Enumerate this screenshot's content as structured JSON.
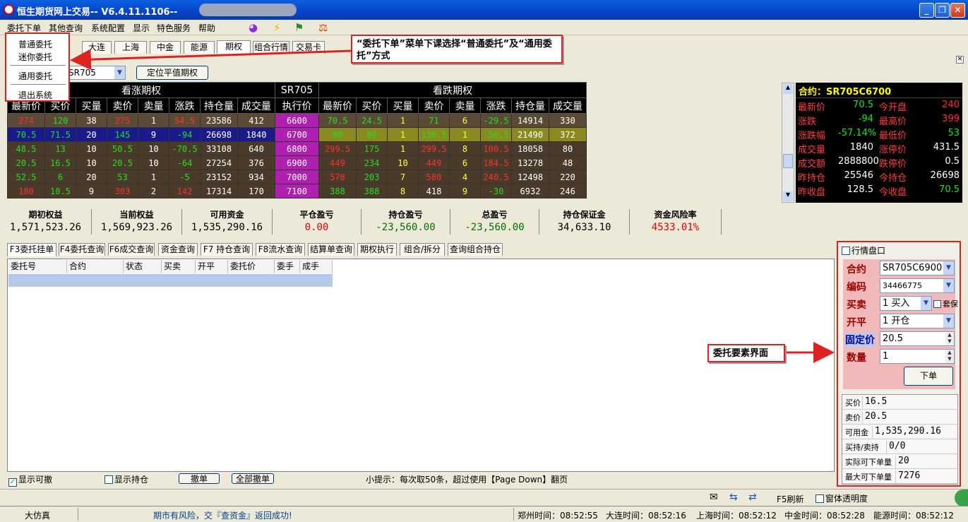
{
  "window": {
    "title": "恒生期货网上交易-- V6.4.11.1106--"
  },
  "menu": {
    "items": [
      "委托下单",
      "其他查询",
      "系统配置",
      "显示",
      "特色服务",
      "帮助"
    ]
  },
  "dropdown": {
    "items": [
      "普通委托",
      "迷你委托",
      "通用委托",
      "退出系统"
    ]
  },
  "callout_menu": "“委托下单”菜单下课选择“普通委托”及“通用委托”方式",
  "callout_panel": "委托要素界面",
  "exch_tabs": [
    "大连",
    "上海",
    "中金",
    "能源",
    "期权",
    "组合行情",
    "交易卡"
  ],
  "contract_select": "SR705",
  "locate_button": "定位平值期权",
  "option": {
    "call_group": "看涨期权",
    "strike_group": "SR705",
    "put_group": "看跌期权",
    "call_headers": [
      "最新价",
      "买价",
      "买量",
      "卖价",
      "卖量",
      "涨跌",
      "持仓量",
      "成交量"
    ],
    "strike_header": "执行价",
    "put_headers": [
      "最新价",
      "买价",
      "买量",
      "卖价",
      "卖量",
      "涨跌",
      "持仓量",
      "成交量"
    ],
    "rows": [
      {
        "c": [
          "274",
          "120",
          "38",
          "275",
          "1",
          "54.5",
          "23586",
          "412"
        ],
        "k": "6600",
        "p": [
          "70.5",
          "24.5",
          "1",
          "71",
          "6",
          "-29.5",
          "14914",
          "330"
        ]
      },
      {
        "c": [
          "70.5",
          "71.5",
          "20",
          "145",
          "9",
          "-94",
          "26698",
          "1840"
        ],
        "k": "6700",
        "p": [
          "88",
          "69",
          "1",
          "136.5",
          "1",
          "-56.5",
          "21490",
          "372"
        ]
      },
      {
        "c": [
          "48.5",
          "13",
          "10",
          "50.5",
          "10",
          "-70.5",
          "33108",
          "640"
        ],
        "k": "6800",
        "p": [
          "299.5",
          "175",
          "1",
          "299.5",
          "8",
          "100.5",
          "18058",
          "80"
        ]
      },
      {
        "c": [
          "20.5",
          "16.5",
          "10",
          "20.5",
          "10",
          "-64",
          "27254",
          "376"
        ],
        "k": "6900",
        "p": [
          "449",
          "234",
          "10",
          "449",
          "6",
          "184.5",
          "13278",
          "48"
        ]
      },
      {
        "c": [
          "52.5",
          "6",
          "20",
          "53",
          "1",
          "-5",
          "23152",
          "934"
        ],
        "k": "7000",
        "p": [
          "578",
          "203",
          "7",
          "580",
          "4",
          "240.5",
          "12498",
          "220"
        ]
      },
      {
        "c": [
          "180",
          "10.5",
          "9",
          "303",
          "2",
          "142",
          "17314",
          "170"
        ],
        "k": "7100",
        "p": [
          "388",
          "388",
          "8",
          "418",
          "9",
          "-30",
          "6932",
          "246"
        ]
      }
    ]
  },
  "quote": {
    "title": "合约：SR705C6700",
    "rows": [
      {
        "l": "最新价",
        "v": "70.5",
        "l2": "今开盘",
        "v2": "240"
      },
      {
        "l": "涨跌",
        "v": "-94",
        "l2": "最高价",
        "v2": "399"
      },
      {
        "l": "涨跌幅",
        "v": "-57.14%",
        "l2": "最低价",
        "v2": "53"
      },
      {
        "l": "成交量",
        "v": "1840",
        "l2": "涨停价",
        "v2": "431.5"
      },
      {
        "l": "成交额",
        "v": "2888800",
        "l2": "跌停价",
        "v2": "0.5"
      },
      {
        "l": "昨持仓",
        "v": "25546",
        "l2": "今持仓",
        "v2": "26698"
      },
      {
        "l": "昨收盘",
        "v": "128.5",
        "l2": "今收盘",
        "v2": "70.5"
      }
    ]
  },
  "account": [
    {
      "h": "期初权益",
      "v": "1,571,523.26",
      "c": "#000"
    },
    {
      "h": "当前权益",
      "v": "1,569,923.26",
      "c": "#000"
    },
    {
      "h": "可用资金",
      "v": "1,535,290.16",
      "c": "#000"
    },
    {
      "h": "平仓盈亏",
      "v": "0.00",
      "c": "#e00000"
    },
    {
      "h": "持仓盈亏",
      "v": "-23,560.00",
      "c": "#007000"
    },
    {
      "h": "总盈亏",
      "v": "-23,560.00",
      "c": "#007000"
    },
    {
      "h": "持仓保证金",
      "v": "34,633.10",
      "c": "#000"
    },
    {
      "h": "资金风险率",
      "v": "4533.01%",
      "c": "#e00000"
    }
  ],
  "lower_tabs": [
    "F3委托挂单",
    "F4委托查询",
    "F6成交查询",
    "资金查询",
    "F7 持仓查询",
    "F8流水查询",
    "结算单查询",
    "期权执行",
    "组合/拆分",
    "查询组合持仓"
  ],
  "order_cols": [
    "委托号",
    "合约",
    "状态",
    "买卖",
    "开平",
    "委托价",
    "委手",
    "成手"
  ],
  "bottom": {
    "show_cancelable": "显示可撤",
    "show_position": "显示持仓",
    "cancel": "撤单",
    "cancel_all": "全部撤单",
    "tip": "小提示：每次取50条，超过使用【Page Down】翻页"
  },
  "panel": {
    "market_check": "行情盘口",
    "contract_label": "合约",
    "contract": "SR705C6900",
    "code_label": "编码",
    "code": "34466775",
    "bs_label": "买卖",
    "bs": "1 买入",
    "hedge": "套保",
    "oc_label": "开平",
    "oc": "1 开仓",
    "price_label": "固定价",
    "price": "20.5",
    "qty_label": "数量",
    "qty": "1",
    "submit": "下单",
    "info": [
      {
        "k": "买价",
        "v": "16.5"
      },
      {
        "k": "卖价",
        "v": "20.5"
      },
      {
        "k": "可用金",
        "v": "1,535,290.16"
      },
      {
        "k": "买持/卖持",
        "v": "0/0"
      },
      {
        "k": "实际可下单量",
        "v": "20"
      },
      {
        "k": "最大可下单量",
        "v": "7276"
      }
    ]
  },
  "bottombar": {
    "refresh": "F5刷新",
    "transparency": "窗体透明度"
  },
  "status": {
    "mode": "大仿真",
    "msg": "期市有风险，交『查资金』返回成功!",
    "zz": "郑州时间：08:52:55",
    "dl": "大连时间：08:52:16",
    "sh": "上海时间：08:52:12",
    "zj": "中金时间：08:52:28",
    "ny": "能源时间：08:52:12"
  }
}
